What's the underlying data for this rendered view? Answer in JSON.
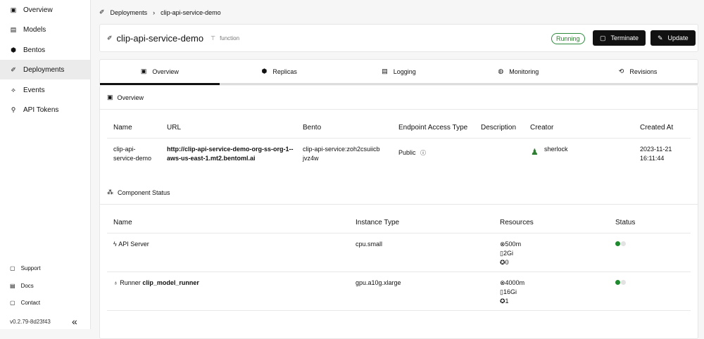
{
  "sidebar": {
    "items": [
      {
        "label": "Overview",
        "icon": "overview-icon"
      },
      {
        "label": "Models",
        "icon": "model-icon"
      },
      {
        "label": "Bentos",
        "icon": "bento-icon"
      },
      {
        "label": "Deployments",
        "icon": "rocket-icon"
      },
      {
        "label": "Events",
        "icon": "activity-icon"
      },
      {
        "label": "API Tokens",
        "icon": "key-icon"
      }
    ],
    "footer": [
      {
        "label": "Support"
      },
      {
        "label": "Docs"
      },
      {
        "label": "Contact"
      }
    ],
    "version": "v0.2.79-8d23f43"
  },
  "breadcrumb": {
    "parent": "Deployments",
    "current": "clip-api-service-demo"
  },
  "header": {
    "title": "clip-api-service-demo",
    "kind": "function",
    "status": "Running",
    "terminate": "Terminate",
    "update": "Update"
  },
  "tabs": [
    "Overview",
    "Replicas",
    "Logging",
    "Monitoring",
    "Revisions"
  ],
  "overview": {
    "title": "Overview",
    "columns": [
      "Name",
      "URL",
      "Bento",
      "Endpoint Access Type",
      "Description",
      "Creator",
      "Created At"
    ],
    "row": {
      "name": "clip-api-service-demo",
      "url": "http://clip-api-service-demo-org-ss-org-1--aws-us-east-1.mt2.bentoml.ai",
      "bento": "clip-api-service:zoh2csuiicbjvz4w",
      "access": "Public",
      "description": "",
      "creator": "sherlock",
      "created": "2023-11-21 16:11:44"
    }
  },
  "components": {
    "title": "Component Status",
    "columns": [
      "Name",
      "Instance Type",
      "Resources",
      "Status"
    ],
    "rows": [
      {
        "prefix": "API Server",
        "name": "",
        "instance": "cpu.small",
        "cpu": "500m",
        "mem": "2Gi",
        "gpu": "0"
      },
      {
        "prefix": "Runner",
        "name": "clip_model_runner",
        "instance": "gpu.a10g.xlarge",
        "cpu": "4000m",
        "mem": "16Gi",
        "gpu": "1"
      }
    ]
  },
  "colors": {
    "running": "#2e7d32",
    "dot_on": "#1e8a2e",
    "dot_off": "#e2e2e2"
  }
}
